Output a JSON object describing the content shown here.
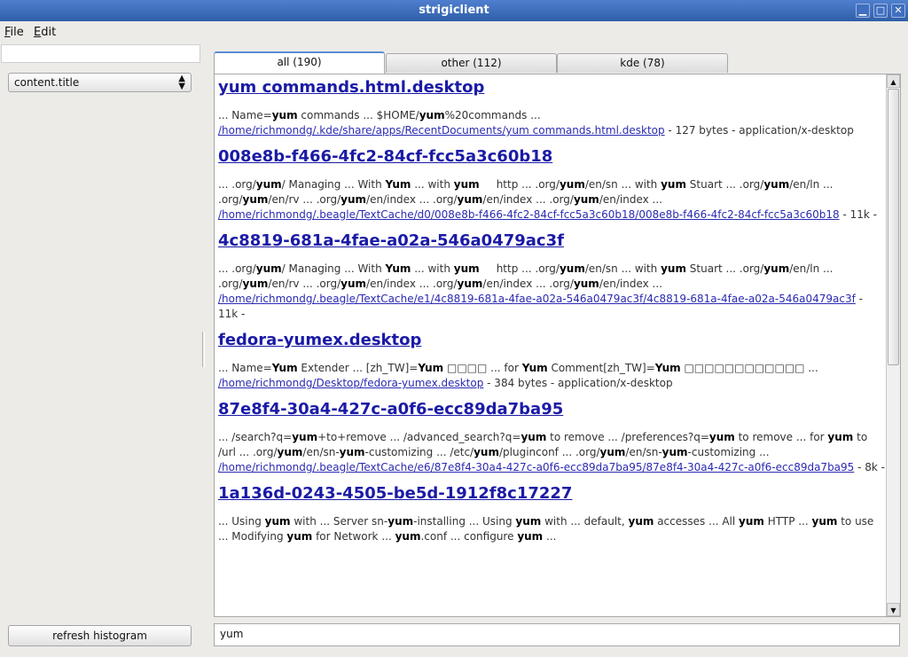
{
  "window": {
    "title": "strigiclient",
    "buttons": [
      "▁",
      "□",
      "✕"
    ]
  },
  "menubar": {
    "file": {
      "first": "F",
      "rest": "ile"
    },
    "edit": {
      "first": "E",
      "rest": "dit"
    }
  },
  "sidebar": {
    "select_value": "content.title",
    "refresh_label": "refresh histogram",
    "filter_value": ""
  },
  "tabs": [
    {
      "label": "all (190)",
      "active": true
    },
    {
      "label": "other (112)",
      "active": false
    },
    {
      "label": "kde (78)",
      "active": false
    }
  ],
  "results": [
    {
      "title": "yum commands.html.desktop",
      "fragment_html": "... Name=<b>yum</b> commands ... $HOME/<b>yum</b>%20commands ...",
      "path": "/home/richmondg/.kde/share/apps/RecentDocuments/yum commands.html.desktop",
      "meta": " - 127 bytes - application/x-desktop"
    },
    {
      "title": "008e8b-f466-4fc2-84cf-fcc5a3c60b18",
      "fragment_html": "... .org/<b>yum</b>/ Managing ... With <b>Yum</b> ... with <b>yum</b> &nbsp;&nbsp;&nbsp;&nbsp;http ... .org/<b>yum</b>/en/sn ... with <b>yum</b> Stuart ... .org/<b>yum</b>/en/ln ...<br>.org/<b>yum</b>/en/rv ... .org/<b>yum</b>/en/index ... .org/<b>yum</b>/en/index ... .org/<b>yum</b>/en/index ...",
      "path": "/home/richmondg/.beagle/TextCache/d0/008e8b-f466-4fc2-84cf-fcc5a3c60b18/008e8b-f466-4fc2-84cf-fcc5a3c60b18",
      "meta": " - 11k -"
    },
    {
      "title": "4c8819-681a-4fae-a02a-546a0479ac3f",
      "fragment_html": "... .org/<b>yum</b>/ Managing ... With <b>Yum</b> ... with <b>yum</b> &nbsp;&nbsp;&nbsp;&nbsp;http ... .org/<b>yum</b>/en/sn ... with <b>yum</b> Stuart ... .org/<b>yum</b>/en/ln ...<br>.org/<b>yum</b>/en/rv ... .org/<b>yum</b>/en/index ... .org/<b>yum</b>/en/index ... .org/<b>yum</b>/en/index ...",
      "path": "/home/richmondg/.beagle/TextCache/e1/4c8819-681a-4fae-a02a-546a0479ac3f/4c8819-681a-4fae-a02a-546a0479ac3f",
      "meta": " - 11k -"
    },
    {
      "title": "fedora-yumex.desktop",
      "fragment_html": "... Name=<b>Yum</b> Extender ... [zh_TW]=<b>Yum</b> □□□□ ... for <b>Yum</b> Comment[zh_TW]=<b>Yum</b> □□□□□□□□□□□□ ...",
      "path": "/home/richmondg/Desktop/fedora-yumex.desktop",
      "meta": " - 384 bytes - application/x-desktop"
    },
    {
      "title": "87e8f4-30a4-427c-a0f6-ecc89da7ba95",
      "fragment_html": "... /search?q=<b>yum</b>+to+remove ... /advanced_search?q=<b>yum</b> to remove ... /preferences?q=<b>yum</b> to remove ... for <b>yum</b> to<br>/url ... .org/<b>yum</b>/en/sn-<b>yum</b>-customizing ... /etc/<b>yum</b>/pluginconf ... .org/<b>yum</b>/en/sn-<b>yum</b>-customizing ...",
      "path": "/home/richmondg/.beagle/TextCache/e6/87e8f4-30a4-427c-a0f6-ecc89da7ba95/87e8f4-30a4-427c-a0f6-ecc89da7ba95",
      "meta": " - 8k -"
    },
    {
      "title": "1a136d-0243-4505-be5d-1912f8c17227",
      "fragment_html": "... Using <b>yum</b> with ... Server sn-<b>yum</b>-installing ... Using <b>yum</b> with ... default, <b>yum</b> accesses ... All <b>yum</b> HTTP ... <b>yum</b> to use<br>... Modifying <b>yum</b> for Network ... <b>yum</b>.conf ... configure <b>yum</b> ...",
      "path": "",
      "meta": ""
    }
  ],
  "query": {
    "value": "yum"
  }
}
